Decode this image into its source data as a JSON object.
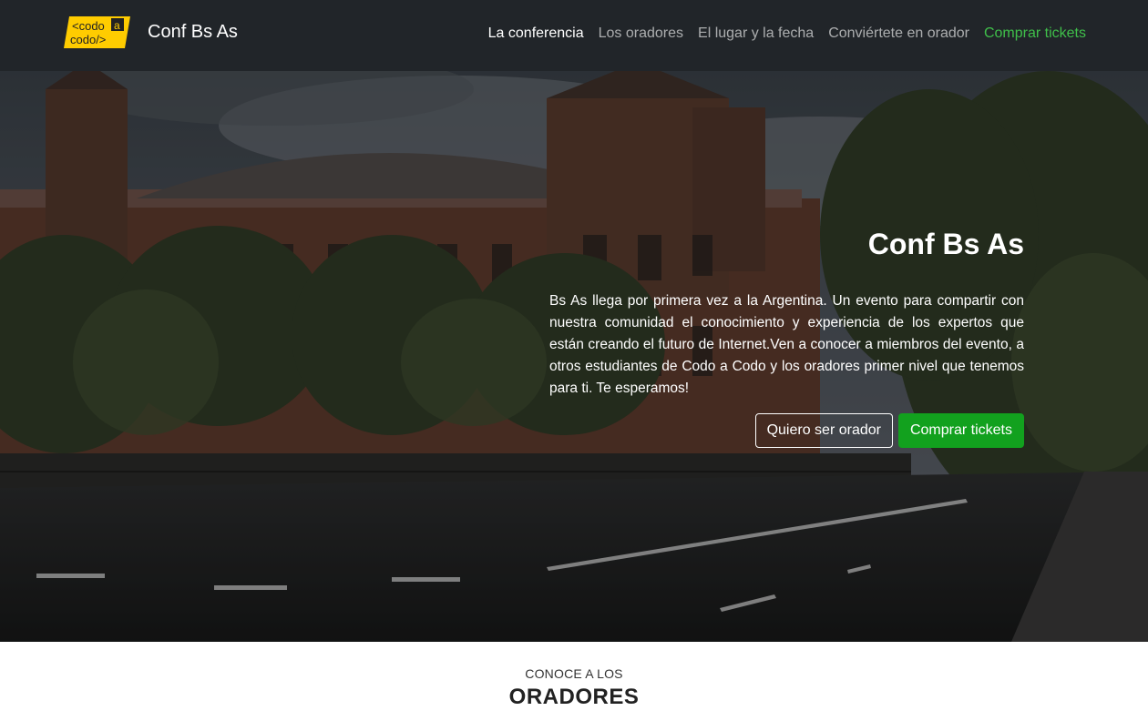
{
  "navbar": {
    "logo": {
      "line1": "<codo",
      "accent": "a",
      "line2": "codo/>",
      "color": "#ffcc00"
    },
    "brand": "Conf Bs As",
    "links": [
      {
        "label": "La conferencia",
        "state": "active"
      },
      {
        "label": "Los oradores"
      },
      {
        "label": "El lugar y la fecha"
      },
      {
        "label": "Conviértete en orador"
      },
      {
        "label": "Comprar tickets",
        "state": "highlight"
      }
    ]
  },
  "hero": {
    "title": "Conf Bs As",
    "text": "Bs As llega por primera vez a la Argentina. Un evento para compartir con nuestra comunidad el conocimiento y experiencia de los expertos que están creando el futuro de Internet.Ven a conocer a miembros del evento, a otros estudiantes de Codo a Codo y los oradores primer nivel que tenemos para ti. Te esperamos!",
    "buttons": {
      "speaker": "Quiero ser orador",
      "tickets": "Comprar tickets"
    }
  },
  "speakers": {
    "pretitle": "CONOCE A LOS",
    "title": "ORADORES"
  },
  "colors": {
    "navbar_bg": "#212529",
    "accent_green": "#12a11e",
    "link_green": "#3fbf4a"
  }
}
